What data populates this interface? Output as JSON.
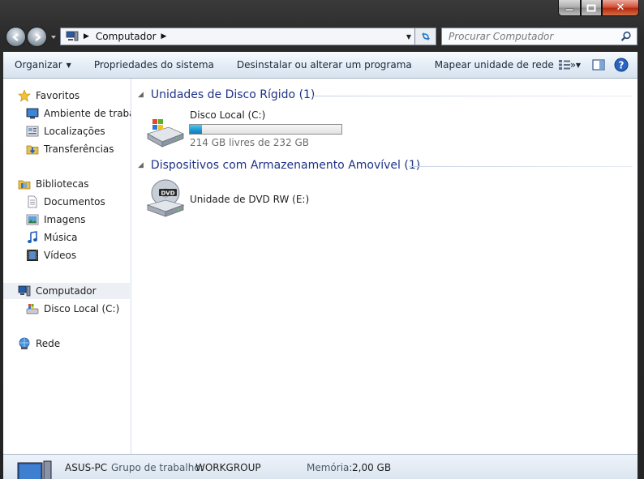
{
  "window": {
    "caption": {
      "minimize": "minimize",
      "maximize": "maximize",
      "close": "close"
    }
  },
  "nav": {
    "address": {
      "crumbs": [
        "Computador"
      ]
    },
    "search": {
      "placeholder": "Procurar Computador"
    }
  },
  "toolbar": {
    "organize": "Organizar",
    "items": [
      "Propriedades do sistema",
      "Desinstalar ou alterar um programa",
      "Mapear unidade de rede"
    ],
    "more": "»"
  },
  "sidebar": {
    "favorites_header": "Favoritos",
    "favorites": [
      "Ambiente de trabalho",
      "Localizações",
      "Transferências"
    ],
    "libraries_header": "Bibliotecas",
    "libraries": [
      "Documentos",
      "Imagens",
      "Música",
      "Vídeos"
    ],
    "computer_header": "Computador",
    "computer_items": [
      "Disco Local (C:)"
    ],
    "network_header": "Rede"
  },
  "content": {
    "groups": [
      {
        "title": "Unidades de Disco Rígido (1)",
        "items": [
          {
            "name": "Disco Local (C:)",
            "free_text": "214 GB livres de 232 GB",
            "used_fraction": 0.078
          }
        ]
      },
      {
        "title": "Dispositivos com Armazenamento Amovível (1)",
        "items": [
          {
            "name": "Unidade de DVD RW (E:)"
          }
        ]
      }
    ]
  },
  "details": {
    "computer_name": "ASUS-PC",
    "workgroup_label": "Grupo de trabalho:",
    "workgroup_value": "WORKGROUP",
    "memory_label": "Memória:",
    "memory_value": "2,00 GB"
  },
  "colors": {
    "group_header": "#1e3287",
    "capacity_fill": "#1d9bd6"
  },
  "icons": [
    "back-arrow-icon",
    "forward-arrow-icon",
    "computer-icon",
    "refresh-icon",
    "search-icon",
    "view-icon",
    "preview-pane-icon",
    "help-icon",
    "star-icon",
    "desktop-icon",
    "places-icon",
    "downloads-icon",
    "library-icon",
    "document-icon",
    "image-icon",
    "music-icon",
    "video-icon",
    "hard-drive-icon",
    "dvd-drive-icon",
    "network-icon"
  ]
}
